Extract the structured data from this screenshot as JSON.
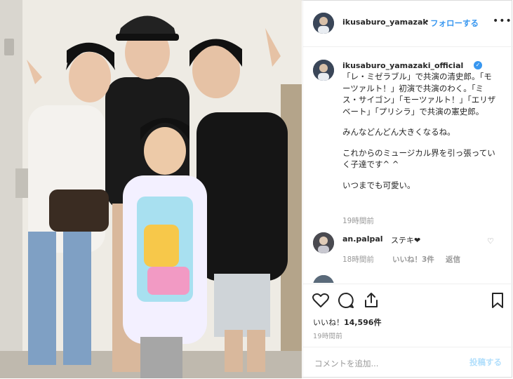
{
  "header": {
    "username": "ikusaburo_yamazak",
    "dot": "•",
    "follow_label": "フォローする",
    "more_label": "•••"
  },
  "caption": {
    "username": "ikusaburo_yamazaki_official",
    "verified_mark": "✓",
    "paragraphs": [
      "「レ・ミゼラブル」で共演の清史郎。「モーツァルト！」初演で共演のわく。「ミス・サイゴン」「モーツァルト！」「エリザベート」「プリシラ」で共演の憲史郎。",
      "みんなどんどん大きくなるね。",
      "これからのミュージカル界を引っ張っていく子達です^ ^",
      "いつまでも可愛い。"
    ],
    "time": "19時間前"
  },
  "comment": {
    "username": "an.palpal",
    "text": "ステキ❤",
    "time": "18時間前",
    "likes": "いいね！3件",
    "reply_label": "返信"
  },
  "actions": {
    "likes_prefix": "いいね！",
    "likes_count": "14,596件",
    "time": "19時間前"
  },
  "add_comment": {
    "placeholder": "コメントを追加...",
    "post_label": "投稿する"
  },
  "colors": {
    "accent": "#3897f0",
    "post_disabled": "#b2dffc"
  }
}
